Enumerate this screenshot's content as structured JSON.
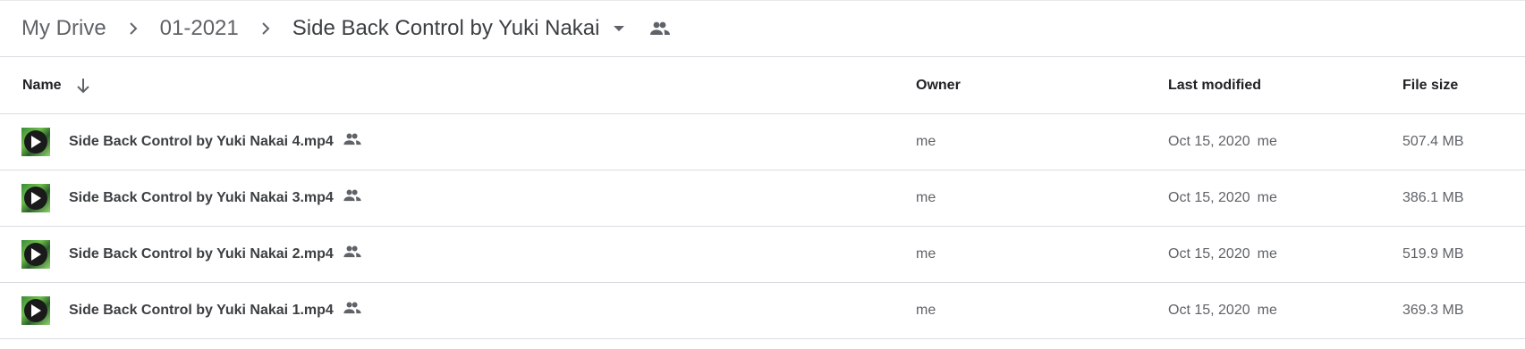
{
  "breadcrumb": {
    "items": [
      {
        "label": "My Drive"
      },
      {
        "label": "01-2021"
      },
      {
        "label": "Side Back Control by Yuki Nakai"
      }
    ],
    "icons": {
      "separator": "chevron-right-icon",
      "dropdown": "arrow-drop-down-icon",
      "shared": "people-icon"
    }
  },
  "table": {
    "columns": {
      "name": "Name",
      "owner": "Owner",
      "last_modified": "Last modified",
      "file_size": "File size"
    },
    "sort": {
      "column": "name",
      "direction": "descending",
      "icon": "arrow-down-icon"
    },
    "rows": [
      {
        "name": "Side Back Control by Yuki Nakai 4.mp4",
        "owner": "me",
        "modified_date": "Oct 15, 2020",
        "modified_by": "me",
        "size": "507.4 MB",
        "shared": true
      },
      {
        "name": "Side Back Control by Yuki Nakai 3.mp4",
        "owner": "me",
        "modified_date": "Oct 15, 2020",
        "modified_by": "me",
        "size": "386.1 MB",
        "shared": true
      },
      {
        "name": "Side Back Control by Yuki Nakai 2.mp4",
        "owner": "me",
        "modified_date": "Oct 15, 2020",
        "modified_by": "me",
        "size": "519.9 MB",
        "shared": true
      },
      {
        "name": "Side Back Control by Yuki Nakai 1.mp4",
        "owner": "me",
        "modified_date": "Oct 15, 2020",
        "modified_by": "me",
        "size": "369.3 MB",
        "shared": true
      }
    ]
  },
  "colors": {
    "primary_text": "#202124",
    "secondary_text": "#5f6368",
    "divider": "#dadce0",
    "icon": "#5f6368"
  }
}
